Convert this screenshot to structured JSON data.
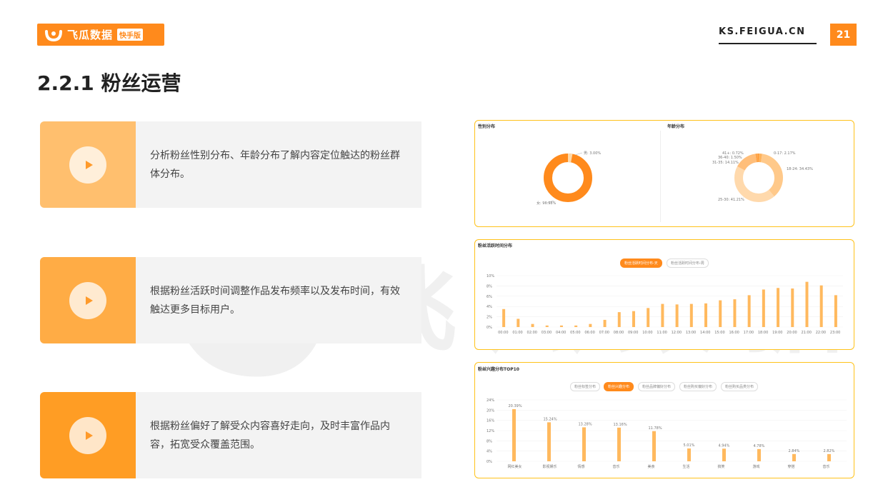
{
  "header": {
    "logo_text": "飞瓜数据",
    "logo_badge": "快手版",
    "site_url": "KS.FEIGUA.CN",
    "page_number": "21"
  },
  "section_title": "2.2.1 粉丝运营",
  "watermark": "飞瓜数据",
  "features": [
    {
      "text": "分析粉丝性别分布、年龄分布了解内容定位触达的粉丝群体分布。",
      "color": "#ffbf6e"
    },
    {
      "text": "根据粉丝活跃时间调整作品发布频率以及发布时间，有效触达更多目标用户。",
      "color": "#ffac45"
    },
    {
      "text": "根据粉丝偏好了解受众内容喜好走向，及时丰富作品内容，拓宽受众覆盖范围。",
      "color": "#ff9d24"
    }
  ],
  "panel_gender": {
    "title": "性别分布",
    "chart_data": {
      "type": "pie",
      "categories": [
        "男",
        "女"
      ],
      "labels": [
        "男: 3.00%",
        "女: 96.98%"
      ],
      "values": [
        3.0,
        96.98
      ]
    }
  },
  "panel_age": {
    "title": "年龄分布",
    "chart_data": {
      "type": "pie",
      "labels": [
        "0-17: 2.17%",
        "18-24: 34.43%",
        "25-30: 41.21%",
        "31-35: 14.11%",
        "36-40: 1.50%",
        "41+: 0.72%"
      ],
      "categories": [
        "0-17",
        "18-24",
        "25-30",
        "31-35",
        "36-40",
        "41+"
      ],
      "values": [
        2.17,
        34.43,
        41.21,
        14.11,
        1.5,
        0.72
      ]
    }
  },
  "panel_active": {
    "title": "粉丝活跃时间分布",
    "tabs": [
      "粉丝活跃时间分布-天",
      "粉丝活跃时间分布-周"
    ],
    "chart_data": {
      "type": "bar",
      "categories": [
        "00:00",
        "01:00",
        "02:00",
        "03:00",
        "04:00",
        "05:00",
        "06:00",
        "07:00",
        "08:00",
        "09:00",
        "10:00",
        "11:00",
        "12:00",
        "13:00",
        "14:00",
        "15:00",
        "16:00",
        "17:00",
        "18:00",
        "19:00",
        "20:00",
        "21:00",
        "22:00",
        "23:00"
      ],
      "values": [
        3.5,
        1.6,
        0.6,
        0.3,
        0.3,
        0.3,
        0.6,
        1.4,
        2.9,
        3.1,
        3.7,
        4.5,
        4.4,
        4.5,
        4.6,
        5.2,
        5.4,
        6.2,
        7.3,
        7.6,
        7.5,
        8.8,
        8.1,
        6.2
      ],
      "yticks": [
        "0%",
        "2%",
        "4%",
        "6%",
        "8%",
        "10%"
      ],
      "ylim": [
        0,
        10
      ]
    }
  },
  "panel_interest": {
    "title": "粉丝兴趣分布TOP10",
    "tabs": [
      "粉丝标签分布",
      "粉丝兴趣分布",
      "粉丝品牌偏好分布",
      "粉丝购买偏好分布",
      "粉丝购买品类分布"
    ],
    "chart_data": {
      "type": "bar",
      "categories": [
        "网红美女",
        "影视娱乐",
        "情感",
        "音乐",
        "美食",
        "生活",
        "搞笑",
        "游戏",
        "穿搭",
        "音乐"
      ],
      "values": [
        20.39,
        15.24,
        13.28,
        13.16,
        11.78,
        5.01,
        4.94,
        4.78,
        2.84,
        2.82
      ],
      "labels": [
        "20.39%",
        "15.24%",
        "13.28%",
        "13.16%",
        "11.78%",
        "5.01%",
        "4.94%",
        "4.78%",
        "2.84%",
        "2.82%"
      ],
      "yticks": [
        "0%",
        "4%",
        "8%",
        "12%",
        "16%",
        "20%",
        "24%"
      ],
      "ylim": [
        0,
        24
      ]
    }
  }
}
